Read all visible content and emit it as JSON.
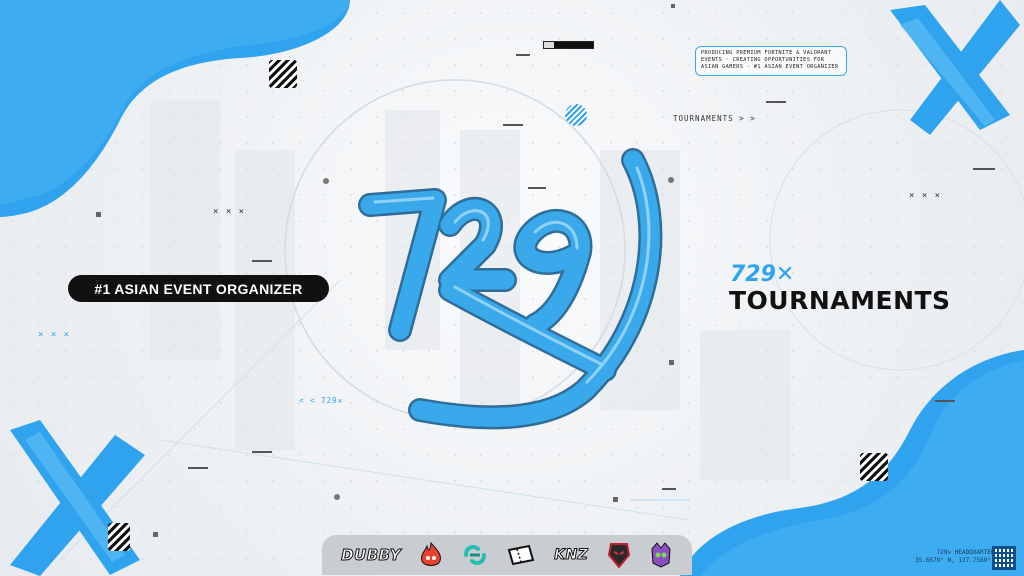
{
  "badge": {
    "text": "#1 ASIAN EVENT ORGANIZER"
  },
  "infobox": {
    "text": "PRODUCING PREMIUM FORTNITE & VALORANT EVENTS · CREATING OPPORTUNITIES FOR ASIAN GAMERS · #1 ASIAN EVENT ORGANIZER"
  },
  "brand": {
    "subtitle": "729✕",
    "title": "TOURNAMENTS"
  },
  "labels": {
    "tournaments_link": "TOURNAMENTS > >",
    "back_link": "< < 729✕",
    "xxx_1": "× × ×",
    "xxx_2": "× × ×",
    "xxx_3": "× × ×"
  },
  "logo": {
    "name": "729x-logo",
    "color": "#3aa9ec"
  },
  "sponsors": [
    {
      "name": "DUBBY",
      "icon": "dubby-logo"
    },
    {
      "name": "",
      "icon": "flame-mascot-logo"
    },
    {
      "name": "",
      "icon": "teal-link-logo"
    },
    {
      "name": "",
      "icon": "ticket-logo"
    },
    {
      "name": "KNZ",
      "icon": "knz-logo"
    },
    {
      "name": "",
      "icon": "red-warrior-logo"
    },
    {
      "name": "",
      "icon": "green-monster-logo"
    }
  ],
  "headquarters": {
    "line1": "729✕ HEADQUARTERS",
    "line2": "35.6579° N, 127.7569° E"
  },
  "colors": {
    "accent": "#3aa9ec",
    "dark": "#111111",
    "background": "#eef1f4"
  }
}
